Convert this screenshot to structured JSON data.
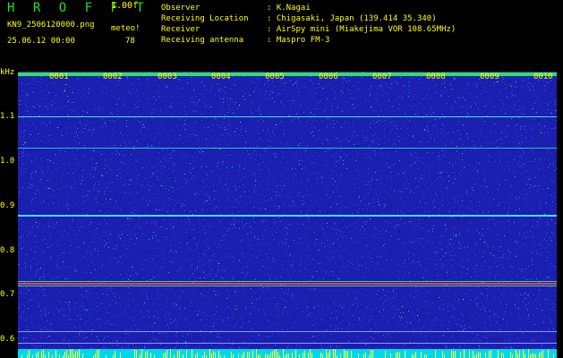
{
  "header": {
    "title": "H R O F F T",
    "speed": "1.00f",
    "filename": "KN9_2506120000.png",
    "meteo": "meteo!",
    "datetime": "25.06.12 00:00",
    "count": "78"
  },
  "info": [
    {
      "key": "Observer",
      "value": ": K.Nagai"
    },
    {
      "key": "Receiving Location",
      "value": ": Chigasaki, Japan (139.414 35.340)"
    },
    {
      "key": "Receiver",
      "value": ": AirSpy mini (Miakejima VOR 108.65MHz)"
    },
    {
      "key": "Receiving antenna",
      "value": ": Maspro FM-3"
    }
  ],
  "axis": {
    "unit": "kHz",
    "labels": [
      "1.1",
      "1.0",
      "0.9",
      "0.8",
      "0.7",
      "0.6"
    ]
  },
  "time_ticks": [
    "0001",
    "0002",
    "0003",
    "0004",
    "0005",
    "0006",
    "0007",
    "0008",
    "0009",
    "0010"
  ],
  "colors": {
    "background": "#000000",
    "text_green": "#20e020",
    "text_yellow": "#ffff00",
    "noise_base": "#1a1fb0",
    "line_cyan": "#40e0e0",
    "line_red": "#ff4040"
  }
}
